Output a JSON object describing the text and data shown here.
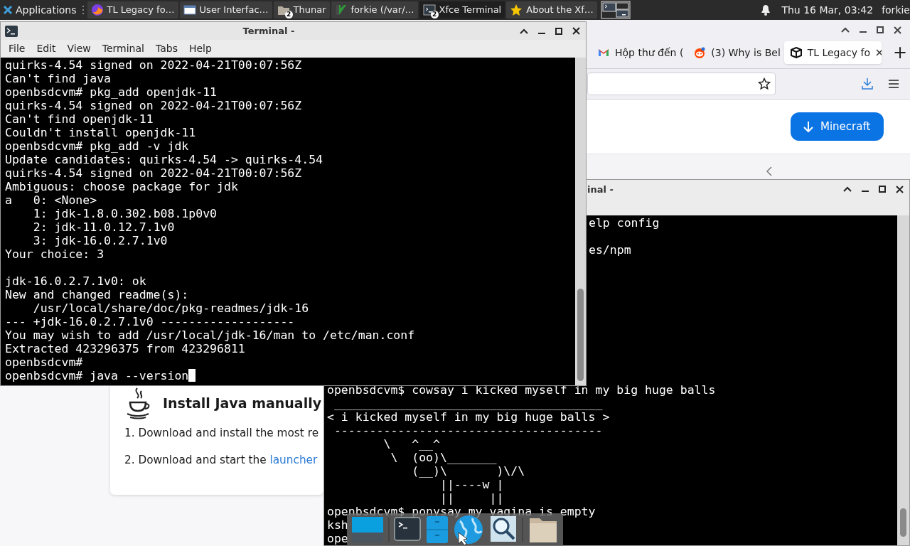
{
  "panel": {
    "apps_label": "Applications",
    "tasks": [
      {
        "label": "TL Legacy fo…",
        "kind": "firefox",
        "selected": false
      },
      {
        "label": "User Interfac…",
        "kind": "window",
        "selected": false
      },
      {
        "label": "Thunar",
        "kind": "folder",
        "badge": "2",
        "selected": false
      },
      {
        "label": "forkie (/var/…",
        "kind": "vim",
        "selected": false
      },
      {
        "label": "Xfce Terminal",
        "kind": "terminal",
        "badge": "2",
        "selected": true
      },
      {
        "label": "About the Xf…",
        "kind": "star",
        "selected": false
      }
    ],
    "clock": "Thu 16 Mar, 03:42",
    "user": "forkie"
  },
  "browser": {
    "tabs": [
      {
        "label": "Hộp thư đến (",
        "kind": "mail",
        "selected": false
      },
      {
        "label": "(3) Why is Bel",
        "kind": "reddit",
        "selected": false
      },
      {
        "label": "TL Legacy fo",
        "kind": "cube",
        "selected": true
      }
    ],
    "new_tab": "+",
    "download_button": "Minecraft",
    "card": {
      "heading": "Install Java manually",
      "steps": [
        {
          "text": "1. Download and install the most re"
        },
        {
          "text": "2. Download and start the ",
          "link": "launcher"
        }
      ]
    }
  },
  "terminal_front": {
    "title": "Terminal -",
    "menu": [
      "File",
      "Edit",
      "View",
      "Terminal",
      "Tabs",
      "Help"
    ],
    "blocks": [
      [
        "quirks-4.54 signed on 2022-04-21T00:07:56Z",
        "Can't find java",
        "openbsdcvm# pkg_add openjdk-11",
        "quirks-4.54 signed on 2022-04-21T00:07:56Z",
        "Can't find openjdk-11",
        "Couldn't install openjdk-11",
        "openbsdcvm# pkg_add -v jdk",
        "Update candidates: quirks-4.54 -> quirks-4.54",
        "quirks-4.54 signed on 2022-04-21T00:07:56Z",
        "Ambiguous: choose package for jdk",
        "a\t0: <None>",
        "\t1: jdk-1.8.0.302.b08.1p0v0",
        "\t2: jdk-11.0.12.7.1v0",
        "\t3: jdk-16.0.2.7.1v0",
        "Your choice: 3"
      ],
      [
        "jdk-16.0.2.7.1v0: ok",
        "New and changed readme(s):",
        "\t/usr/local/share/doc/pkg-readmes/jdk-16",
        "--- +jdk-16.0.2.7.1v0 -------------------",
        "You may wish to add /usr/local/jdk-16/man to /etc/man.conf",
        "Extracted 423296375 from 423296811",
        "openbsdcvm#",
        "openbsdcvm# java --version"
      ]
    ]
  },
  "terminal_back": {
    "title": "inal -",
    "upper_lines": [
      "elp config",
      "es/npm"
    ],
    "lines": [
      "openbsdcvm$ cowsay i kicked myself in my big huge balls",
      " ______________________________________",
      "< i kicked myself in my big huge balls >",
      " --------------------------------------",
      "        \\   ^__^",
      "         \\  (oo)\\_______",
      "            (__)\\       )\\/\\",
      "                ||----w |",
      "                ||     ||",
      "openbsdcvm$ ponysay my vagina is empty",
      "ksh",
      "ope"
    ]
  }
}
